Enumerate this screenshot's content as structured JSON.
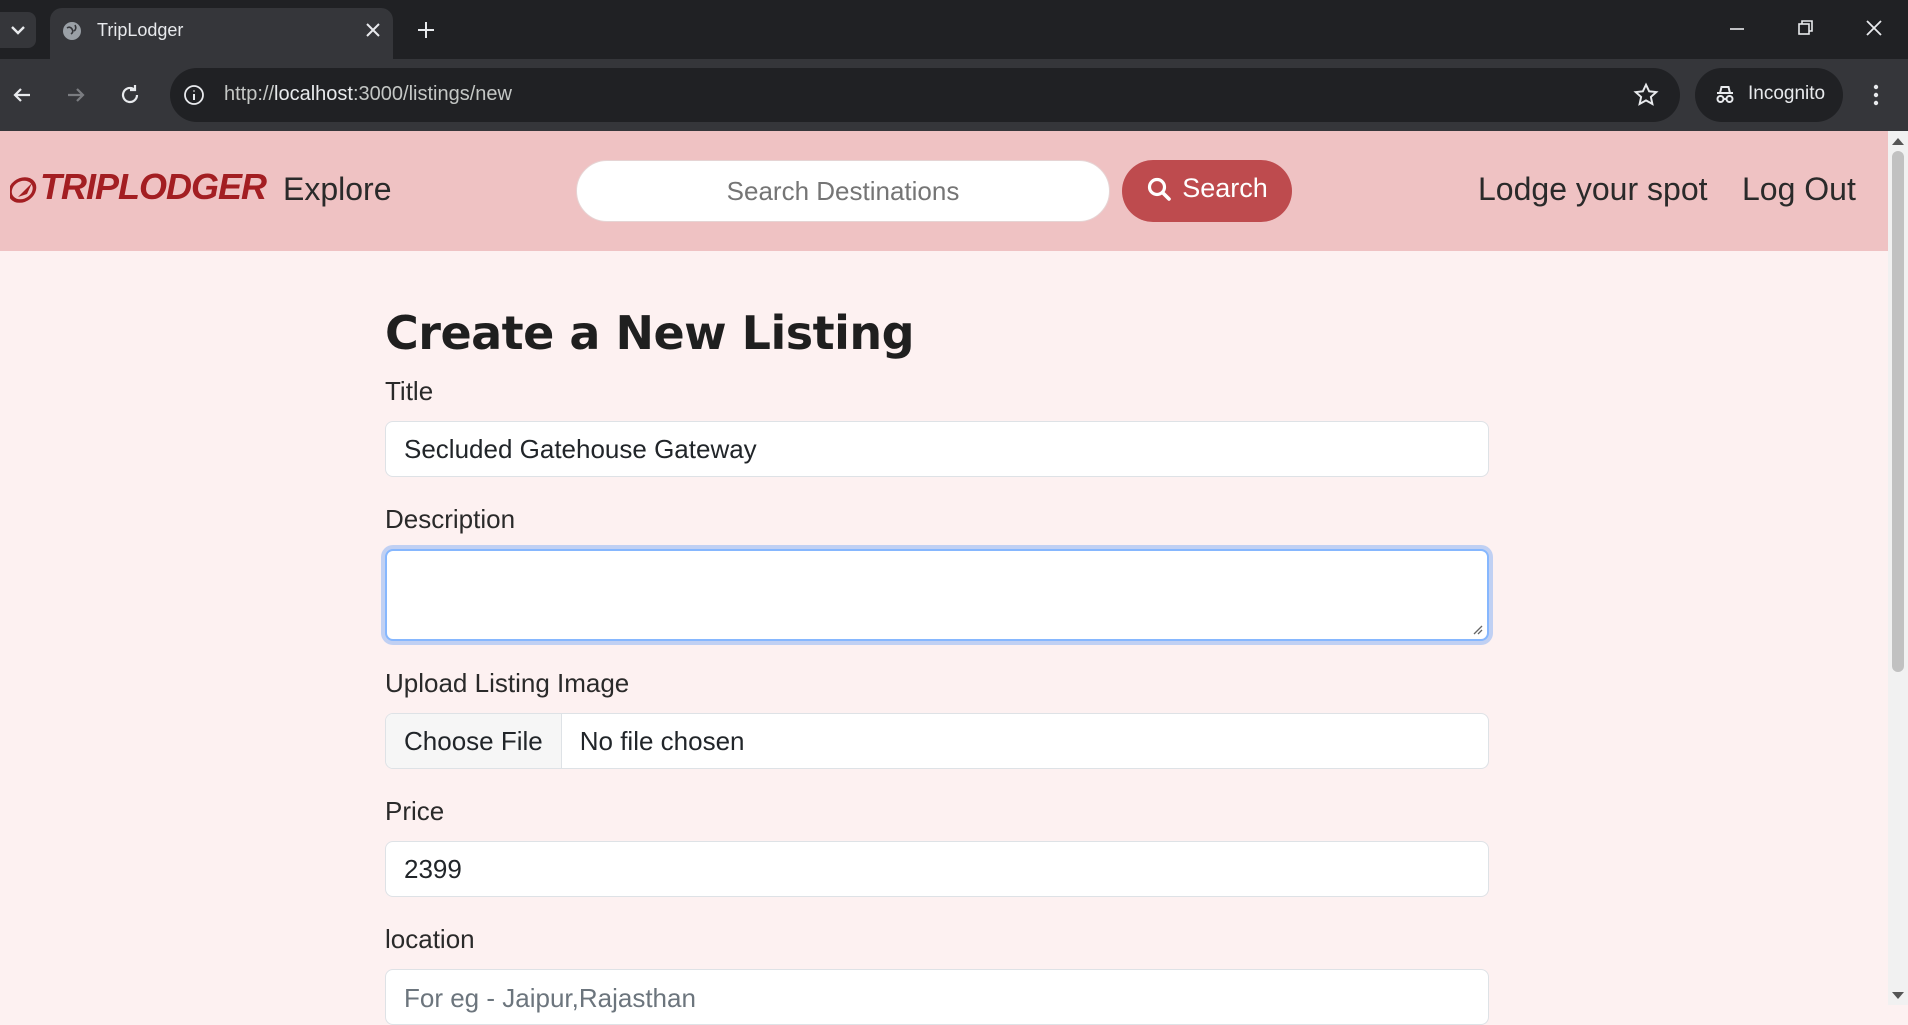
{
  "browser": {
    "tab_title": "TripLodger",
    "url_prefix": "http://",
    "url_host": "localhost",
    "url_path": ":3000/listings/new",
    "profile_label": "Incognito"
  },
  "navbar": {
    "brand": "TRIPLODGER",
    "explore": "Explore",
    "search_placeholder": "Search Destinations",
    "search_button": "Search",
    "lodge_link": "Lodge your spot",
    "logout_link": "Log Out"
  },
  "form": {
    "heading": "Create a New Listing",
    "title_label": "Title",
    "title_value": "Secluded Gatehouse Gateway",
    "description_label": "Description",
    "description_value": "",
    "image_label": "Upload Listing Image",
    "file_button": "Choose File",
    "file_status": "No file chosen",
    "price_label": "Price",
    "price_value": "2399",
    "location_label": "location",
    "location_placeholder": "For eg - Jaipur,Rajasthan"
  },
  "colors": {
    "navbar_bg": "#efc2c3",
    "brand": "#a31e22",
    "search_button": "#be4b4e",
    "page_bg": "#fdf1f1"
  }
}
